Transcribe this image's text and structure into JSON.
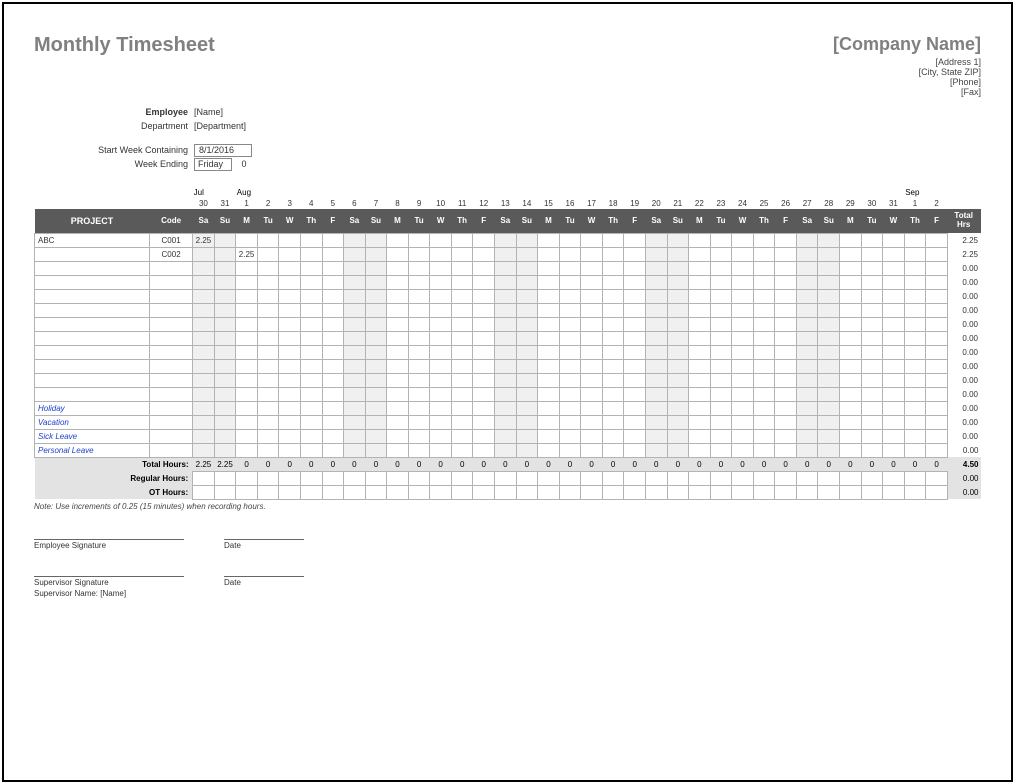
{
  "title": "Monthly Timesheet",
  "company": {
    "name": "[Company Name]",
    "addr1": "[Address 1]",
    "addr2": "[City, State ZIP]",
    "phone": "[Phone]",
    "fax": "[Fax]"
  },
  "meta": {
    "employee_label": "Employee",
    "employee_value": "[Name]",
    "department_label": "Department",
    "department_value": "[Department]",
    "start_label": "Start Week Containing",
    "start_value": "8/1/2016",
    "ending_label": "Week Ending",
    "ending_value": "Friday",
    "ending_num": "0"
  },
  "months": [
    "Jul",
    "Aug",
    "Sep"
  ],
  "month_starts": [
    0,
    2,
    33
  ],
  "dates": [
    "30",
    "31",
    "1",
    "2",
    "3",
    "4",
    "5",
    "6",
    "7",
    "8",
    "9",
    "10",
    "11",
    "12",
    "13",
    "14",
    "15",
    "16",
    "17",
    "18",
    "19",
    "20",
    "21",
    "22",
    "23",
    "24",
    "25",
    "26",
    "27",
    "28",
    "29",
    "30",
    "31",
    "1",
    "2"
  ],
  "headers": {
    "project": "PROJECT",
    "code": "Code",
    "total": "Total Hrs"
  },
  "dow": [
    "Sa",
    "Su",
    "M",
    "Tu",
    "W",
    "Th",
    "F",
    "Sa",
    "Su",
    "M",
    "Tu",
    "W",
    "Th",
    "F",
    "Sa",
    "Su",
    "M",
    "Tu",
    "W",
    "Th",
    "F",
    "Sa",
    "Su",
    "M",
    "Tu",
    "W",
    "Th",
    "F",
    "Sa",
    "Su",
    "M",
    "Tu",
    "W",
    "Th",
    "F"
  ],
  "weekend_idx": [
    0,
    1,
    7,
    8,
    14,
    15,
    21,
    22,
    28,
    29
  ],
  "rows": [
    {
      "project": "ABC",
      "code": "C001",
      "cells": [
        "2.25",
        "",
        "",
        "",
        "",
        "",
        "",
        "",
        "",
        "",
        "",
        "",
        "",
        "",
        "",
        "",
        "",
        "",
        "",
        "",
        "",
        "",
        "",
        "",
        "",
        "",
        "",
        "",
        "",
        "",
        "",
        "",
        "",
        "",
        ""
      ],
      "total": "2.25"
    },
    {
      "project": "",
      "code": "C002",
      "cells": [
        "",
        "",
        "2.25",
        "",
        "",
        "",
        "",
        "",
        "",
        "",
        "",
        "",
        "",
        "",
        "",
        "",
        "",
        "",
        "",
        "",
        "",
        "",
        "",
        "",
        "",
        "",
        "",
        "",
        "",
        "",
        "",
        "",
        "",
        "",
        ""
      ],
      "total": "2.25"
    },
    {
      "project": "",
      "code": "",
      "cells": [
        "",
        "",
        "",
        "",
        "",
        "",
        "",
        "",
        "",
        "",
        "",
        "",
        "",
        "",
        "",
        "",
        "",
        "",
        "",
        "",
        "",
        "",
        "",
        "",
        "",
        "",
        "",
        "",
        "",
        "",
        "",
        "",
        "",
        "",
        ""
      ],
      "total": "0.00"
    },
    {
      "project": "",
      "code": "",
      "cells": [
        "",
        "",
        "",
        "",
        "",
        "",
        "",
        "",
        "",
        "",
        "",
        "",
        "",
        "",
        "",
        "",
        "",
        "",
        "",
        "",
        "",
        "",
        "",
        "",
        "",
        "",
        "",
        "",
        "",
        "",
        "",
        "",
        "",
        "",
        ""
      ],
      "total": "0.00"
    },
    {
      "project": "",
      "code": "",
      "cells": [
        "",
        "",
        "",
        "",
        "",
        "",
        "",
        "",
        "",
        "",
        "",
        "",
        "",
        "",
        "",
        "",
        "",
        "",
        "",
        "",
        "",
        "",
        "",
        "",
        "",
        "",
        "",
        "",
        "",
        "",
        "",
        "",
        "",
        "",
        ""
      ],
      "total": "0.00"
    },
    {
      "project": "",
      "code": "",
      "cells": [
        "",
        "",
        "",
        "",
        "",
        "",
        "",
        "",
        "",
        "",
        "",
        "",
        "",
        "",
        "",
        "",
        "",
        "",
        "",
        "",
        "",
        "",
        "",
        "",
        "",
        "",
        "",
        "",
        "",
        "",
        "",
        "",
        "",
        "",
        ""
      ],
      "total": "0.00"
    },
    {
      "project": "",
      "code": "",
      "cells": [
        "",
        "",
        "",
        "",
        "",
        "",
        "",
        "",
        "",
        "",
        "",
        "",
        "",
        "",
        "",
        "",
        "",
        "",
        "",
        "",
        "",
        "",
        "",
        "",
        "",
        "",
        "",
        "",
        "",
        "",
        "",
        "",
        "",
        "",
        ""
      ],
      "total": "0.00"
    },
    {
      "project": "",
      "code": "",
      "cells": [
        "",
        "",
        "",
        "",
        "",
        "",
        "",
        "",
        "",
        "",
        "",
        "",
        "",
        "",
        "",
        "",
        "",
        "",
        "",
        "",
        "",
        "",
        "",
        "",
        "",
        "",
        "",
        "",
        "",
        "",
        "",
        "",
        "",
        "",
        ""
      ],
      "total": "0.00"
    },
    {
      "project": "",
      "code": "",
      "cells": [
        "",
        "",
        "",
        "",
        "",
        "",
        "",
        "",
        "",
        "",
        "",
        "",
        "",
        "",
        "",
        "",
        "",
        "",
        "",
        "",
        "",
        "",
        "",
        "",
        "",
        "",
        "",
        "",
        "",
        "",
        "",
        "",
        "",
        "",
        ""
      ],
      "total": "0.00"
    },
    {
      "project": "",
      "code": "",
      "cells": [
        "",
        "",
        "",
        "",
        "",
        "",
        "",
        "",
        "",
        "",
        "",
        "",
        "",
        "",
        "",
        "",
        "",
        "",
        "",
        "",
        "",
        "",
        "",
        "",
        "",
        "",
        "",
        "",
        "",
        "",
        "",
        "",
        "",
        "",
        ""
      ],
      "total": "0.00"
    },
    {
      "project": "",
      "code": "",
      "cells": [
        "",
        "",
        "",
        "",
        "",
        "",
        "",
        "",
        "",
        "",
        "",
        "",
        "",
        "",
        "",
        "",
        "",
        "",
        "",
        "",
        "",
        "",
        "",
        "",
        "",
        "",
        "",
        "",
        "",
        "",
        "",
        "",
        "",
        "",
        ""
      ],
      "total": "0.00"
    },
    {
      "project": "",
      "code": "",
      "cells": [
        "",
        "",
        "",
        "",
        "",
        "",
        "",
        "",
        "",
        "",
        "",
        "",
        "",
        "",
        "",
        "",
        "",
        "",
        "",
        "",
        "",
        "",
        "",
        "",
        "",
        "",
        "",
        "",
        "",
        "",
        "",
        "",
        "",
        "",
        ""
      ],
      "total": "0.00"
    },
    {
      "project": "Holiday",
      "code": "",
      "italic": true,
      "cells": [
        "",
        "",
        "",
        "",
        "",
        "",
        "",
        "",
        "",
        "",
        "",
        "",
        "",
        "",
        "",
        "",
        "",
        "",
        "",
        "",
        "",
        "",
        "",
        "",
        "",
        "",
        "",
        "",
        "",
        "",
        "",
        "",
        "",
        "",
        ""
      ],
      "total": "0.00"
    },
    {
      "project": "Vacation",
      "code": "",
      "italic": true,
      "cells": [
        "",
        "",
        "",
        "",
        "",
        "",
        "",
        "",
        "",
        "",
        "",
        "",
        "",
        "",
        "",
        "",
        "",
        "",
        "",
        "",
        "",
        "",
        "",
        "",
        "",
        "",
        "",
        "",
        "",
        "",
        "",
        "",
        "",
        "",
        ""
      ],
      "total": "0.00"
    },
    {
      "project": "Sick Leave",
      "code": "",
      "italic": true,
      "cells": [
        "",
        "",
        "",
        "",
        "",
        "",
        "",
        "",
        "",
        "",
        "",
        "",
        "",
        "",
        "",
        "",
        "",
        "",
        "",
        "",
        "",
        "",
        "",
        "",
        "",
        "",
        "",
        "",
        "",
        "",
        "",
        "",
        "",
        "",
        ""
      ],
      "total": "0.00"
    },
    {
      "project": "Personal Leave",
      "code": "",
      "italic": true,
      "cells": [
        "",
        "",
        "",
        "",
        "",
        "",
        "",
        "",
        "",
        "",
        "",
        "",
        "",
        "",
        "",
        "",
        "",
        "",
        "",
        "",
        "",
        "",
        "",
        "",
        "",
        "",
        "",
        "",
        "",
        "",
        "",
        "",
        "",
        "",
        ""
      ],
      "total": "0.00"
    }
  ],
  "totals": {
    "total_label": "Total Hours:",
    "total_cells": [
      "2.25",
      "2.25",
      "0",
      "0",
      "0",
      "0",
      "0",
      "0",
      "0",
      "0",
      "0",
      "0",
      "0",
      "0",
      "0",
      "0",
      "0",
      "0",
      "0",
      "0",
      "0",
      "0",
      "0",
      "0",
      "0",
      "0",
      "0",
      "0",
      "0",
      "0",
      "0",
      "0",
      "0",
      "0",
      "0"
    ],
    "total_sum": "4.50",
    "regular_label": "Regular Hours:",
    "regular_cells": [
      "",
      "",
      "",
      "",
      "",
      "",
      "",
      "",
      "",
      "",
      "",
      "",
      "",
      "",
      "",
      "",
      "",
      "",
      "",
      "",
      "",
      "",
      "",
      "",
      "",
      "",
      "",
      "",
      "",
      "",
      "",
      "",
      "",
      "",
      ""
    ],
    "regular_sum": "0.00",
    "ot_label": "OT Hours:",
    "ot_cells": [
      "",
      "",
      "",
      "",
      "",
      "",
      "",
      "",
      "",
      "",
      "",
      "",
      "",
      "",
      "",
      "",
      "",
      "",
      "",
      "",
      "",
      "",
      "",
      "",
      "",
      "",
      "",
      "",
      "",
      "",
      "",
      "",
      "",
      "",
      ""
    ],
    "ot_sum": "0.00"
  },
  "note": "Note: Use increments of 0.25 (15 minutes) when recording hours.",
  "sig": {
    "emp": "Employee Signature",
    "date": "Date",
    "sup": "Supervisor Signature",
    "supname_label": "Supervisor Name:",
    "supname_value": "[Name]"
  }
}
